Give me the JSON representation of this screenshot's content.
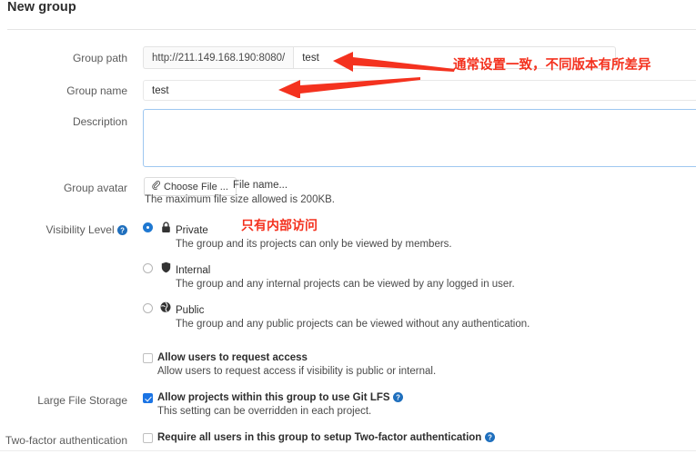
{
  "page": {
    "title": "New group"
  },
  "form": {
    "group_path": {
      "label": "Group path",
      "prefix": "http://211.149.168.190:8080/",
      "value": "test",
      "placeholder": ""
    },
    "group_name": {
      "label": "Group name",
      "value": "test",
      "placeholder": ""
    },
    "description": {
      "label": "Description",
      "value": "",
      "placeholder": ""
    },
    "group_avatar": {
      "label": "Group avatar",
      "choose_file_label": "Choose File ...",
      "file_name_text": "File name...",
      "hint": "The maximum file size allowed is 200KB."
    },
    "visibility": {
      "label": "Visibility Level",
      "help_icon": "help-circle-icon",
      "selected": "private",
      "options": [
        {
          "id": "private",
          "icon": "lock-icon",
          "title": "Private",
          "description": "The group and its projects can only be viewed by members.",
          "checked": true
        },
        {
          "id": "internal",
          "icon": "shield-icon",
          "title": "Internal",
          "description": "The group and any internal projects can be viewed by any logged in user.",
          "checked": false
        },
        {
          "id": "public",
          "icon": "globe-icon",
          "title": "Public",
          "description": "The group and any public projects can be viewed without any authentication.",
          "checked": false
        }
      ]
    },
    "request_access": {
      "label": "",
      "checkbox_label": "Allow users to request access",
      "description": "Allow users to request access if visibility is public or internal.",
      "checked": false
    },
    "large_file_storage": {
      "label": "Large File Storage",
      "checkbox_label": "Allow projects within this group to use Git LFS",
      "help_icon": "help-circle-icon",
      "description": "This setting can be overridden in each project.",
      "checked": true
    },
    "two_factor": {
      "label": "Two-factor authentication",
      "checkbox_label": "Require all users in this group to setup Two-factor authentication",
      "help_icon": "help-circle-icon",
      "checked": false
    }
  },
  "annotations": {
    "color": "#f4321f",
    "path_note": "通常设置一致，不同版本有所差异",
    "visibility_note": "只有内部访问",
    "arrow_path": "arrow-left-icon",
    "arrow_name": "arrow-left-icon"
  }
}
